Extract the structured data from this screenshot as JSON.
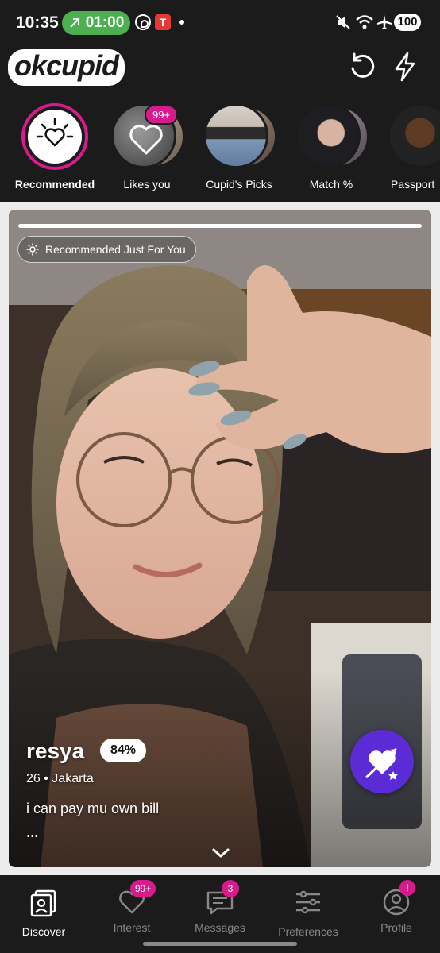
{
  "status_bar": {
    "time": "10:35",
    "call_timer": "01:00",
    "battery": "100",
    "icons": [
      "call-arrow-icon",
      "whatsapp-icon",
      "t-app-icon",
      "notification-dot-icon",
      "mute-icon",
      "wifi-icon",
      "airplane-icon"
    ]
  },
  "header": {
    "logo": "okcupid",
    "actions": [
      "undo-icon",
      "boost-icon"
    ]
  },
  "categories": [
    {
      "label": "Recommended",
      "active": true,
      "icon": "sun-heart-icon"
    },
    {
      "label": "Likes you",
      "badge": "99+",
      "icon": "heart-icon"
    },
    {
      "label": "Cupid's Picks"
    },
    {
      "label": "Match %"
    },
    {
      "label": "Passport"
    }
  ],
  "card": {
    "chip": "Recommended Just For You",
    "name": "resya",
    "match": "84%",
    "meta": "26 • Jakarta",
    "bio": "i can pay mu own bill",
    "more": "...",
    "photo_progress": 1.0,
    "superlike_icon": "heart-arrow-icon",
    "expand_icon": "chevron-down-icon"
  },
  "bottom_nav": [
    {
      "label": "Discover",
      "active": true,
      "icon": "discover-icon"
    },
    {
      "label": "Interest",
      "badge": "99+",
      "icon": "heart-outline-icon"
    },
    {
      "label": "Messages",
      "badge": "3",
      "icon": "chat-icon"
    },
    {
      "label": "Preferences",
      "icon": "sliders-icon"
    },
    {
      "label": "Profile",
      "badge": "!",
      "icon": "person-icon"
    }
  ],
  "colors": {
    "background": "#1b1b1b",
    "accent_pink": "#d81b8c",
    "call_green": "#4caf50",
    "superlike_purple": "#5b2bd6"
  }
}
